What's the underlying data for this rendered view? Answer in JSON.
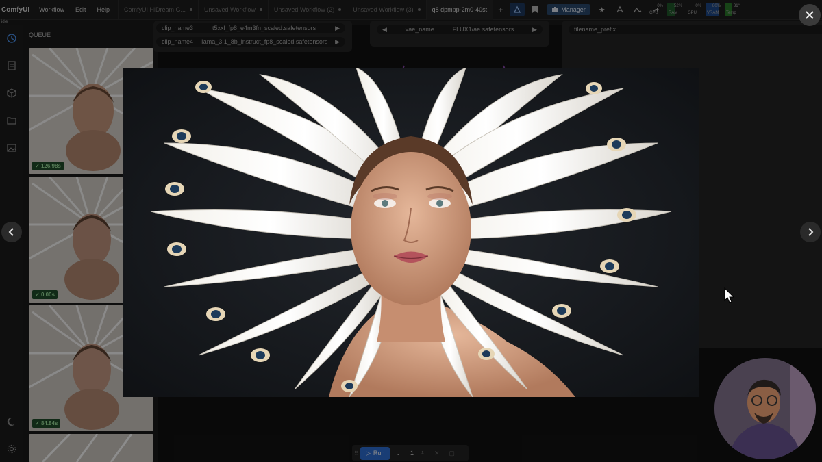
{
  "app": {
    "logo": "ComfyUI",
    "status": "idle"
  },
  "menu": [
    "Workflow",
    "Edit",
    "Help"
  ],
  "tabs": [
    {
      "label": "ComfyUI HiDream G...",
      "active": false
    },
    {
      "label": "Unsaved Workflow",
      "active": false
    },
    {
      "label": "Unsaved Workflow (2)",
      "active": false
    },
    {
      "label": "Unsaved Workflow (3)",
      "active": false
    },
    {
      "label": "q8 dpmpp-2m0-40st",
      "active": true
    }
  ],
  "toolbar": {
    "manager_label": "Manager"
  },
  "stats": {
    "cpu": {
      "label": "CPU",
      "value": "0%"
    },
    "ram": {
      "label": "RAM",
      "value": "52%"
    },
    "gpu": {
      "label": "GPU",
      "value": "0%"
    },
    "vram": {
      "label": "VRAM",
      "value": "80%"
    },
    "temp": {
      "label": "Temp",
      "value": "31°"
    }
  },
  "queue": {
    "title": "QUEUE",
    "items": [
      {
        "time": "126.98s"
      },
      {
        "time": "0.00s"
      },
      {
        "time": "84.84s"
      }
    ]
  },
  "nodes": {
    "clip_name3_label": "clip_name3",
    "clip_name3_value": "t5xxl_fp8_e4m3fn_scaled.safetensors",
    "clip_name4_label": "clip_name4",
    "clip_name4_value": "llama_3.1_8b_instruct_fp8_scaled.safetensors",
    "vae_label": "vae_name",
    "vae_value": "FLUX1/ae.safetensors",
    "filename_prefix": "filename_prefix"
  },
  "run": {
    "label": "Run",
    "count": "1"
  },
  "colors": {
    "accent": "#2f6fd6",
    "success": "#9fe39f"
  }
}
